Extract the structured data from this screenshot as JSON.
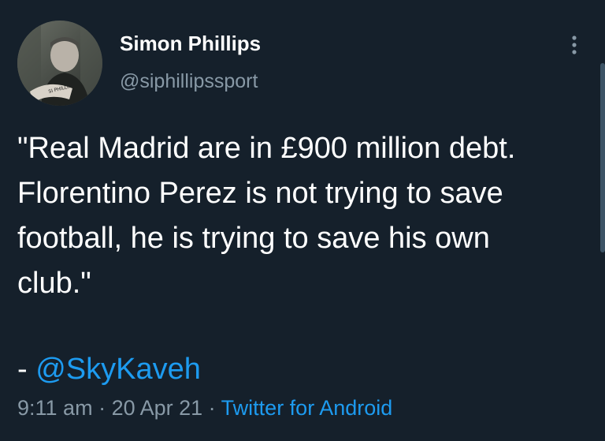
{
  "author": {
    "name": "Simon Phillips",
    "handle": "@siphillipssport"
  },
  "tweet": {
    "text": "\"Real Madrid are in £900 million debt.\nFlorentino Perez is not trying to save\nfootball, he is trying to save his own\nclub.\"",
    "attribution_prefix": "- ",
    "mention": "@SkyKaveh"
  },
  "meta": {
    "time": "9:11 am",
    "date": "20 Apr 21",
    "separator": " · ",
    "source": "Twitter for Android"
  },
  "icons": {
    "more": "more-vertical-icon"
  },
  "colors": {
    "background": "#15202b",
    "text": "#ffffff",
    "secondary": "#8899a6",
    "link": "#1d9bf0"
  }
}
